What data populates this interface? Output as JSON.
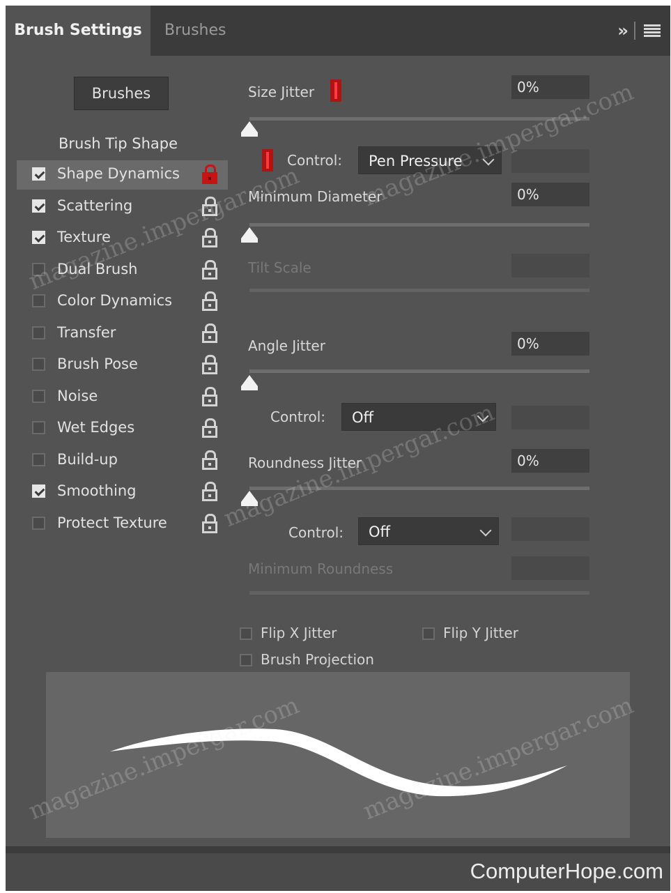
{
  "tabs": [
    {
      "label": "Brush Settings",
      "active": true
    },
    {
      "label": "Brushes",
      "active": false
    }
  ],
  "header_icons": [
    "expand-panel-icon",
    "panel-menu-icon"
  ],
  "brushes_button": "Brushes",
  "brush_tip_shape": "Brush Tip Shape",
  "options": [
    {
      "label": "Shape Dynamics",
      "checked": true,
      "selected": true,
      "lock": "red-lock-icon"
    },
    {
      "label": "Scattering",
      "checked": true,
      "lock": "lock-icon"
    },
    {
      "label": "Texture",
      "checked": true,
      "lock": "lock-icon"
    },
    {
      "label": "Dual Brush",
      "checked": false,
      "lock": "lock-icon"
    },
    {
      "label": "Color Dynamics",
      "checked": false,
      "lock": "lock-icon"
    },
    {
      "label": "Transfer",
      "checked": false,
      "lock": "lock-icon"
    },
    {
      "label": "Brush Pose",
      "checked": false,
      "lock": "lock-icon"
    },
    {
      "label": "Noise",
      "checked": false,
      "lock": "lock-icon"
    },
    {
      "label": "Wet Edges",
      "checked": false,
      "lock": "lock-icon"
    },
    {
      "label": "Build-up",
      "checked": false,
      "lock": "lock-icon"
    },
    {
      "label": "Smoothing",
      "checked": true,
      "lock": "lock-icon"
    },
    {
      "label": "Protect Texture",
      "checked": false,
      "lock": "lock-icon"
    }
  ],
  "size_jitter": {
    "label": "Size Jitter",
    "value": "0%",
    "slider": 0
  },
  "control1": {
    "label": "Control:",
    "value": "Pen Pressure"
  },
  "min_diameter": {
    "label": "Minimum Diameter",
    "value": "0%",
    "slider": 0
  },
  "tilt_scale": {
    "label": "Tilt Scale"
  },
  "angle_jitter": {
    "label": "Angle Jitter",
    "value": "0%",
    "slider": 0
  },
  "control2": {
    "label": "Control:",
    "value": "Off"
  },
  "roundness_jitter": {
    "label": "Roundness Jitter",
    "value": "0%",
    "slider": 0
  },
  "control3": {
    "label": "Control:",
    "value": "Off"
  },
  "min_roundness": {
    "label": "Minimum Roundness"
  },
  "flip_x": {
    "label": "Flip X Jitter",
    "checked": false
  },
  "flip_y": {
    "label": "Flip Y Jitter",
    "checked": false
  },
  "brush_projection": {
    "label": "Brush Projection",
    "checked": false
  },
  "credit": "ComputerHope.com",
  "watermarks": [
    "magazine.impergar.com",
    "magazine.impergar.com",
    "magazine.impergar.com",
    "magazine.impergar.com",
    "magazine.impergar.com"
  ],
  "colors": {
    "panel": "#535353",
    "tabbar": "#3b3b3b",
    "warning": "#c41414"
  }
}
